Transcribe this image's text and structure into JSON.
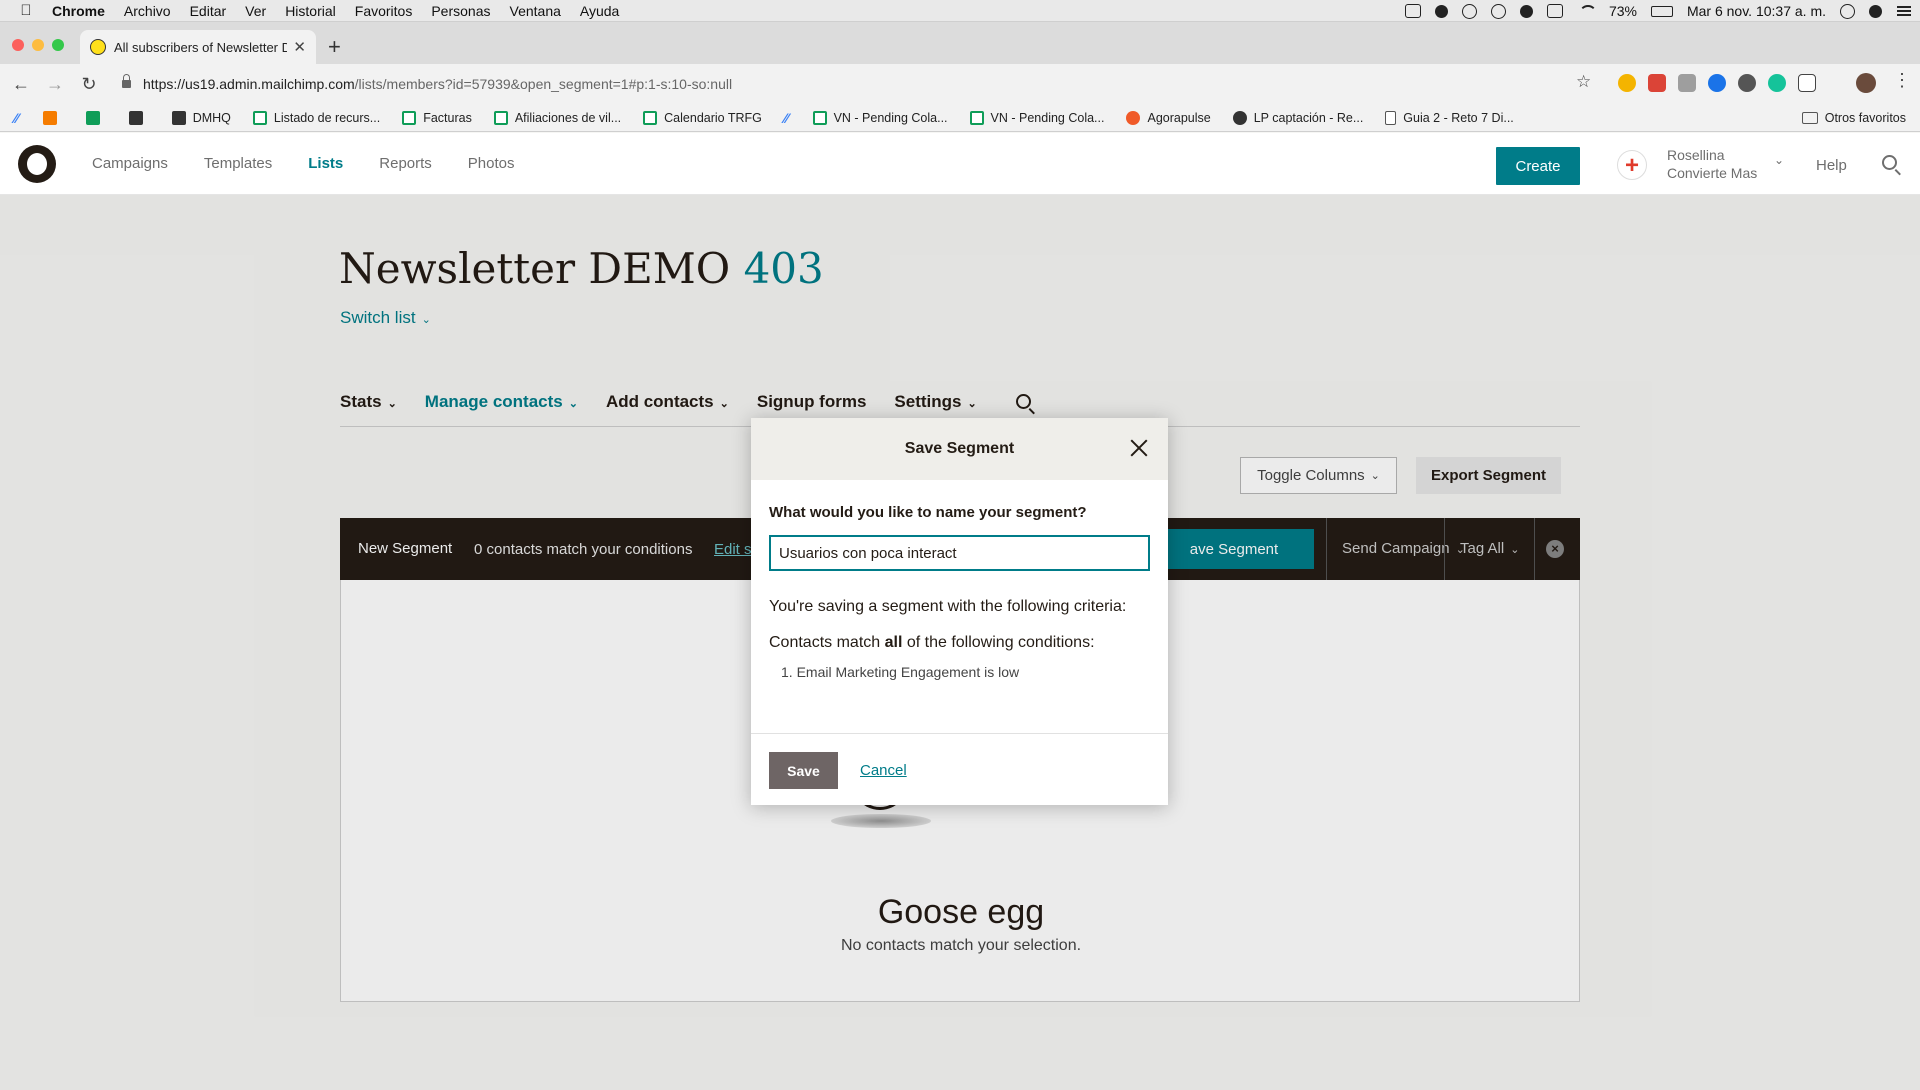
{
  "menubar": {
    "app": "Chrome",
    "items": [
      "Archivo",
      "Editar",
      "Ver",
      "Historial",
      "Favoritos",
      "Personas",
      "Ventana",
      "Ayuda"
    ],
    "battery": "73%",
    "datetime": "Mar 6 nov.  10:37 a. m."
  },
  "browser": {
    "tab_title": "All subscribers of Newsletter D",
    "url_host": "https://us19.admin.mailchimp.com",
    "url_path": "/lists/members?id=57939&open_segment=1#p:1-s:10-so:null",
    "bookmarks": [
      "DMHQ",
      "Listado de recurs...",
      "Facturas",
      "Afiliaciones de vil...",
      "Calendario TRFG",
      "VN - Pending Cola...",
      "VN - Pending Cola...",
      "Agorapulse",
      "LP captación - Re...",
      "Guia 2 - Reto 7 Di..."
    ],
    "other_bookmarks": "Otros favoritos"
  },
  "header": {
    "nav": [
      "Campaigns",
      "Templates",
      "Lists",
      "Reports",
      "Photos"
    ],
    "active_nav": "Lists",
    "create": "Create",
    "account_line1": "Rosellina",
    "account_line2": "Convierte Mas",
    "help": "Help"
  },
  "list": {
    "title": "Newsletter DEMO",
    "count": "403",
    "switch_list": "Switch list"
  },
  "subnav": {
    "stats": "Stats",
    "manage": "Manage contacts",
    "add": "Add contacts",
    "signup": "Signup forms",
    "settings": "Settings"
  },
  "actions": {
    "toggle_columns": "Toggle Columns",
    "export_segment": "Export Segment"
  },
  "segment_bar": {
    "label": "New Segment",
    "match_text": "0 contacts match your conditions",
    "edit": "Edit s",
    "save": "ave Segment",
    "send_campaign": "Send Campaign",
    "tag_all": "Tag All"
  },
  "empty_state": {
    "title": "Goose egg",
    "subtitle": "No contacts match your selection."
  },
  "modal": {
    "title": "Save Segment",
    "question": "What would you like to name your segment?",
    "input_value": "Usuarios con poca interact",
    "criteria_intro": "You're saving a segment with the following criteria:",
    "match_prefix": "Contacts match ",
    "match_bold": "all",
    "match_suffix": " of the following conditions:",
    "conditions": [
      "Email Marketing Engagement is low"
    ],
    "save": "Save",
    "cancel": "Cancel"
  }
}
